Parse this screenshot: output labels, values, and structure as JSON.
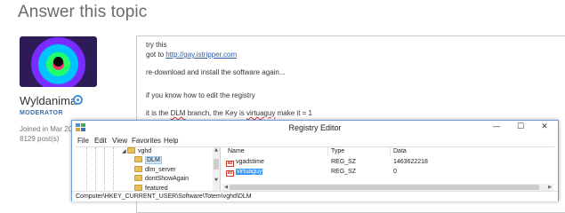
{
  "page": {
    "title": "Answer this topic"
  },
  "author": {
    "name": "Wyldanimal",
    "role": "MODERATOR",
    "joined": "Joined in Mar 20",
    "posts": "8129 post(s)",
    "verified_icon": "verified-badge-icon"
  },
  "editor": {
    "lines": [
      "try this",
      "got to ",
      "re-download and install the software again...",
      "if you know how to edit the registry",
      "it is the ",
      " branch, the Key is ",
      " make it = 1"
    ],
    "link_text": "http://gay.istripper.com",
    "dlm_text": "DLM",
    "key_text": "virtuaguy"
  },
  "regedit": {
    "title": "Registry Editor",
    "window_buttons": {
      "minimize": "—",
      "maximize": "☐",
      "close": "✕"
    },
    "menu": [
      "File",
      "Edit",
      "View",
      "Favorites",
      "Help"
    ],
    "tree": {
      "parent": "vghd",
      "expander": "◢",
      "children": [
        "DLM",
        "dlm_server",
        "dontShowAgain",
        "featured"
      ],
      "selected": "DLM"
    },
    "columns": [
      "Name",
      "Type",
      "Data"
    ],
    "rows": [
      {
        "name": "vgadstime",
        "type": "REG_SZ",
        "data": "1463622218",
        "icon": "ab"
      },
      {
        "name": "virtuaguy",
        "type": "REG_SZ",
        "data": "0",
        "icon": "ab"
      }
    ],
    "selected_row": "virtuaguy",
    "scroll_arrows": {
      "up": "▲",
      "down": "▼",
      "left": "◀",
      "right": "▶"
    },
    "status_path": "Computer\\HKEY_CURRENT_USER\\Software\\Totem\\vghd\\DLM",
    "icon": "registry-editor-icon"
  }
}
